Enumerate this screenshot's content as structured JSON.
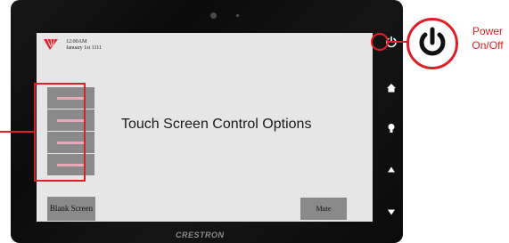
{
  "screen": {
    "time": "12:00AM",
    "date": "January 1st 1111",
    "title": "Touch Screen Control Options",
    "blank_button": "Blank Screen",
    "mute_button": "Mute"
  },
  "brand": "CRESTRON",
  "power_label_line1": "Power",
  "power_label_line2": "On/Off",
  "side_buttons": [
    "power-icon",
    "home-icon",
    "lightbulb-icon",
    "arrow-up-icon",
    "arrow-down-icon"
  ],
  "colors": {
    "highlight": "#e11d25",
    "bezel": "#0b0b0b",
    "screen_bg": "#e6e6e6",
    "button_gray": "#8a8a8a",
    "option_line": "#e9a9b8"
  }
}
